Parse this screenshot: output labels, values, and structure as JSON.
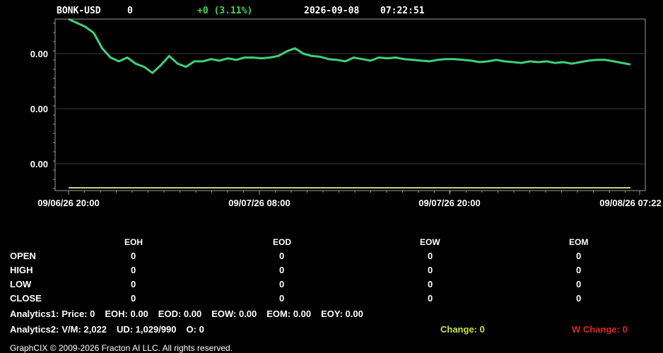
{
  "header": {
    "symbol": "BONK-USD",
    "price": "0",
    "change": "+0 (3.11%)",
    "date": "2026-09-08",
    "time": "07:22:51"
  },
  "colors": {
    "background": "#000000",
    "price_line": "#3dd27a",
    "baseline": "#c8d47a",
    "change_positive": "#3ddc3d",
    "change_label": "#c8e63c",
    "w_change_label": "#e02424"
  },
  "chart_data": {
    "type": "line",
    "y_tick_labels": [
      "0.00",
      "0.00",
      "0.00"
    ],
    "x_tick_labels": [
      "09/06/26 20:00",
      "09/07/26 08:00",
      "09/07/26 20:00",
      "09/08/26 07:22"
    ],
    "grid": true,
    "series": [
      {
        "values": [
          1.0,
          0.95,
          0.9,
          0.82,
          0.62,
          0.5,
          0.45,
          0.5,
          0.42,
          0.38,
          0.3,
          0.4,
          0.52,
          0.42,
          0.38,
          0.45,
          0.45,
          0.48,
          0.46,
          0.49,
          0.47,
          0.5,
          0.5,
          0.49,
          0.5,
          0.52,
          0.58,
          0.62,
          0.55,
          0.52,
          0.51,
          0.48,
          0.47,
          0.45,
          0.5,
          0.48,
          0.46,
          0.5,
          0.49,
          0.5,
          0.48,
          0.47,
          0.46,
          0.45,
          0.47,
          0.48,
          0.48,
          0.47,
          0.46,
          0.44,
          0.45,
          0.47,
          0.45,
          0.44,
          0.43,
          0.45,
          0.44,
          0.45,
          0.43,
          0.44,
          0.42,
          0.44,
          0.46,
          0.47,
          0.47,
          0.45,
          0.43,
          0.41
        ]
      }
    ]
  },
  "table": {
    "columns": [
      "EOH",
      "EOD",
      "EOW",
      "EOM"
    ],
    "rows": [
      {
        "label": "OPEN",
        "values": [
          "0",
          "0",
          "0",
          "0"
        ]
      },
      {
        "label": "HIGH",
        "values": [
          "0",
          "0",
          "0",
          "0"
        ]
      },
      {
        "label": "LOW",
        "values": [
          "0",
          "0",
          "0",
          "0"
        ]
      },
      {
        "label": "CLOSE",
        "values": [
          "0",
          "0",
          "0",
          "0"
        ]
      }
    ]
  },
  "analytics1": {
    "label": "Analytics1:",
    "price": "Price: 0",
    "eoh": "EOH: 0.00",
    "eod": "EOD: 0.00",
    "eow": "EOW: 0.00",
    "eom": "EOM: 0.00",
    "eoy": "EOY: 0.00"
  },
  "analytics2": {
    "label": "Analytics2:",
    "vm": "V/M: 2,022",
    "ud": "UD: 1,029/990",
    "o": "O: 0"
  },
  "change_label": "Change: 0",
  "w_change_label": "W Change: 0",
  "footer": "GraphCIX © 2009-2026 Fracton AI LLC. All rights reserved."
}
